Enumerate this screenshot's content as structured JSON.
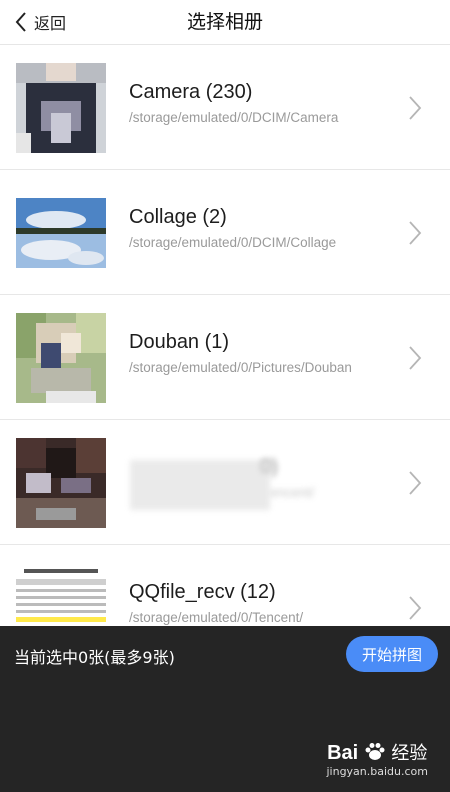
{
  "header": {
    "back_label": "返回",
    "title": "选择相册"
  },
  "albums": [
    {
      "name": "Camera (230)",
      "path": "/storage/emulated/0/DCIM/Camera"
    },
    {
      "name": "Collage (2)",
      "path": "/storage/emulated/0/DCIM/Collage"
    },
    {
      "name": "Douban (1)",
      "path": "/storage/emulated/0/Pictures/Douban"
    },
    {
      "name": "0)",
      "path": "encent/"
    },
    {
      "name": "QQfile_recv (12)",
      "path": "/storage/emulated/0/Tencent/"
    }
  ],
  "bottom": {
    "selection_text": "当前选中0张(最多9张)",
    "start_label": "开始拼图"
  },
  "watermark": {
    "brand": "Bai",
    "brand_suffix": "经验",
    "url": "jingyan.baidu.com"
  },
  "colors": {
    "accent": "#4a8cf7",
    "bottom_bar": "#252525"
  }
}
